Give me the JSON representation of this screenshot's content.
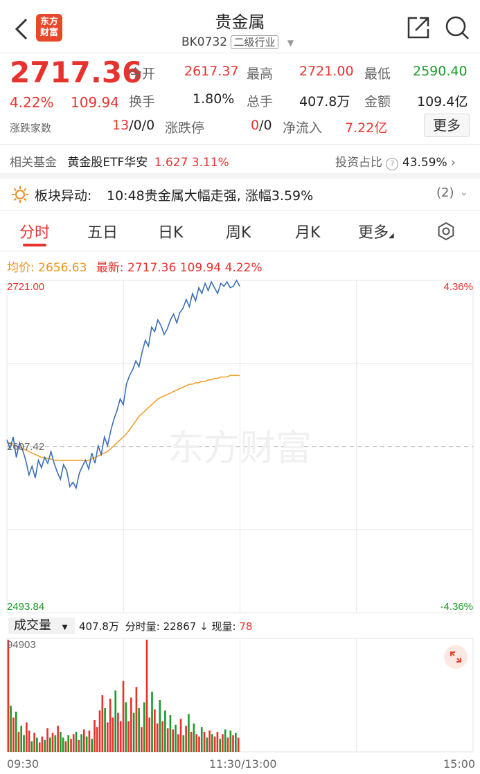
{
  "header": {
    "title": "贵金属",
    "code": "BK0732",
    "tag": "二级行业",
    "logo_text_line1": "东方",
    "logo_text_line2": "财富"
  },
  "quote": {
    "price": "2717.36",
    "change_pct": "4.22%",
    "change": "109.94",
    "rows": [
      [
        {
          "label": "今开",
          "value": "2617.37",
          "color": "red"
        },
        {
          "label": "最高",
          "value": "2721.00",
          "color": "red"
        },
        {
          "label": "最低",
          "value": "2590.40",
          "color": "green"
        }
      ],
      [
        {
          "label": "换手",
          "value": "1.80%",
          "color": "dark"
        },
        {
          "label": "总手",
          "value": "407.8万",
          "color": "dark"
        },
        {
          "label": "金额",
          "value": "109.4亿",
          "color": "dark"
        }
      ]
    ],
    "breadth_label": "涨跌家数",
    "breadth_up": "13",
    "breadth_rest": "/0/0",
    "limit_label": "涨跌停",
    "limit_up": "0",
    "limit_rest": "/0",
    "inflow_label": "净流入",
    "inflow_value": "7.22亿",
    "more_button": "更多"
  },
  "fund": {
    "label": "相关基金",
    "name": "黄金股ETF华安",
    "price": "1.627",
    "pct": "3.11%",
    "ratio_label": "投资占比",
    "ratio_value": "43.59%"
  },
  "alert": {
    "title": "板块异动:",
    "text": "10:48贵金属大幅走强, 涨幅3.59%",
    "count": "(2)"
  },
  "tabs": [
    "分时",
    "五日",
    "日K",
    "周K",
    "月K",
    "更多"
  ],
  "intraday": {
    "avg_label": "均价:",
    "avg_value": "2656.63",
    "latest_label": "最新:",
    "latest_value": "2717.36",
    "latest_change": "109.94",
    "latest_pct": "4.22%",
    "y_top": "2721.00",
    "y_mid": "2607.42",
    "y_bottom": "2493.84",
    "pct_top": "4.36%",
    "pct_bottom": "-4.36%",
    "watermark": "东方财富"
  },
  "volume": {
    "selector": "成交量",
    "total": "407.8万",
    "minute_label": "分时量:",
    "minute_value": "22867",
    "arrow": "↓",
    "now_label": "现量:",
    "now_value": "78",
    "max_label": "94903"
  },
  "x_axis": {
    "start": "09:30",
    "mid": "11:30/13:00",
    "end": "15:00"
  },
  "chart_data": {
    "type": "line",
    "ylim": [
      2493.84,
      2721.0
    ],
    "baseline": 2607.42,
    "series": [
      {
        "values": [
          2612,
          2606,
          2614,
          2600,
          2610,
          2605,
          2598,
          2588,
          2594,
          2586,
          2598,
          2593,
          2600,
          2596,
          2604,
          2596,
          2590,
          2585,
          2595,
          2591,
          2580,
          2583,
          2579,
          2589,
          2594,
          2598,
          2592,
          2603,
          2596,
          2608,
          2602,
          2614,
          2608,
          2618,
          2626,
          2632,
          2640,
          2636,
          2650,
          2656,
          2660,
          2666,
          2662,
          2672,
          2680,
          2676,
          2689,
          2686,
          2694,
          2690,
          2684,
          2688,
          2694,
          2698,
          2692,
          2699,
          2702,
          2708,
          2703,
          2712,
          2707,
          2716,
          2712,
          2719,
          2714,
          2720,
          2716,
          2712,
          2719,
          2717,
          2720,
          2716,
          2717,
          2721,
          2717
        ]
      },
      {
        "values": [
          2610,
          2610,
          2609,
          2608,
          2607,
          2606,
          2605,
          2604,
          2603,
          2602,
          2601,
          2600,
          2600,
          2599,
          2599,
          2598,
          2598,
          2598,
          2598,
          2598,
          2598,
          2598,
          2598,
          2598,
          2598,
          2598,
          2598,
          2599,
          2600,
          2601,
          2602,
          2603,
          2604,
          2606,
          2608,
          2610,
          2612,
          2614,
          2616,
          2619,
          2622,
          2625,
          2628,
          2630,
          2632,
          2634,
          2636,
          2638,
          2640,
          2641,
          2642,
          2643,
          2644,
          2645,
          2646,
          2647,
          2648,
          2649,
          2650,
          2650,
          2651,
          2651,
          2652,
          2652,
          2653,
          2653,
          2654,
          2654,
          2655,
          2655,
          2655,
          2656,
          2656,
          2656,
          2656
        ]
      },
      {
        "name": "成交量",
        "values": [
          94903,
          39000,
          29000,
          34000,
          17000,
          22000,
          14000,
          25000,
          18000,
          9000,
          16000,
          12000,
          8000,
          13000,
          10000,
          20000,
          12000,
          16000,
          14000,
          22000,
          17000,
          12000,
          9000,
          14000,
          11000,
          15000,
          17000,
          10000,
          15000,
          19000,
          13000,
          18000,
          11000,
          27000,
          21000,
          35000,
          48000,
          37000,
          25000,
          45000,
          29000,
          52000,
          33000,
          26000,
          60000,
          42000,
          26000,
          46000,
          33000,
          55000,
          37000,
          21000,
          42000,
          95000,
          29000,
          51000,
          36000,
          24000,
          44000,
          26000,
          35000,
          20000,
          31000,
          19000,
          23000,
          15000,
          28000,
          14000,
          22000,
          32000,
          17000,
          24000,
          15000,
          13000,
          21000,
          17000,
          12000,
          18000,
          15000,
          13000,
          17000,
          11000,
          15000,
          19000,
          12000,
          18000,
          14000,
          16000,
          12000
        ]
      }
    ],
    "up_flags": [
      1,
      0,
      1,
      0,
      1,
      0,
      0,
      1,
      1,
      0,
      1,
      0,
      1,
      1,
      0,
      1,
      0,
      1,
      0,
      1,
      0,
      0,
      1,
      0,
      1,
      1,
      0,
      1,
      0,
      1,
      0,
      1,
      0,
      1,
      1,
      1,
      1,
      0,
      1,
      1,
      1,
      0,
      1,
      1,
      1,
      0,
      1,
      1,
      0,
      1,
      0,
      1,
      0,
      1,
      1,
      0,
      1,
      1,
      0,
      1,
      0,
      1,
      0,
      1,
      0,
      1,
      1,
      0,
      1,
      0,
      1,
      0,
      1,
      1,
      0,
      1,
      0,
      1,
      0,
      1,
      1,
      0,
      1,
      0,
      1,
      0,
      1,
      0,
      1
    ]
  }
}
